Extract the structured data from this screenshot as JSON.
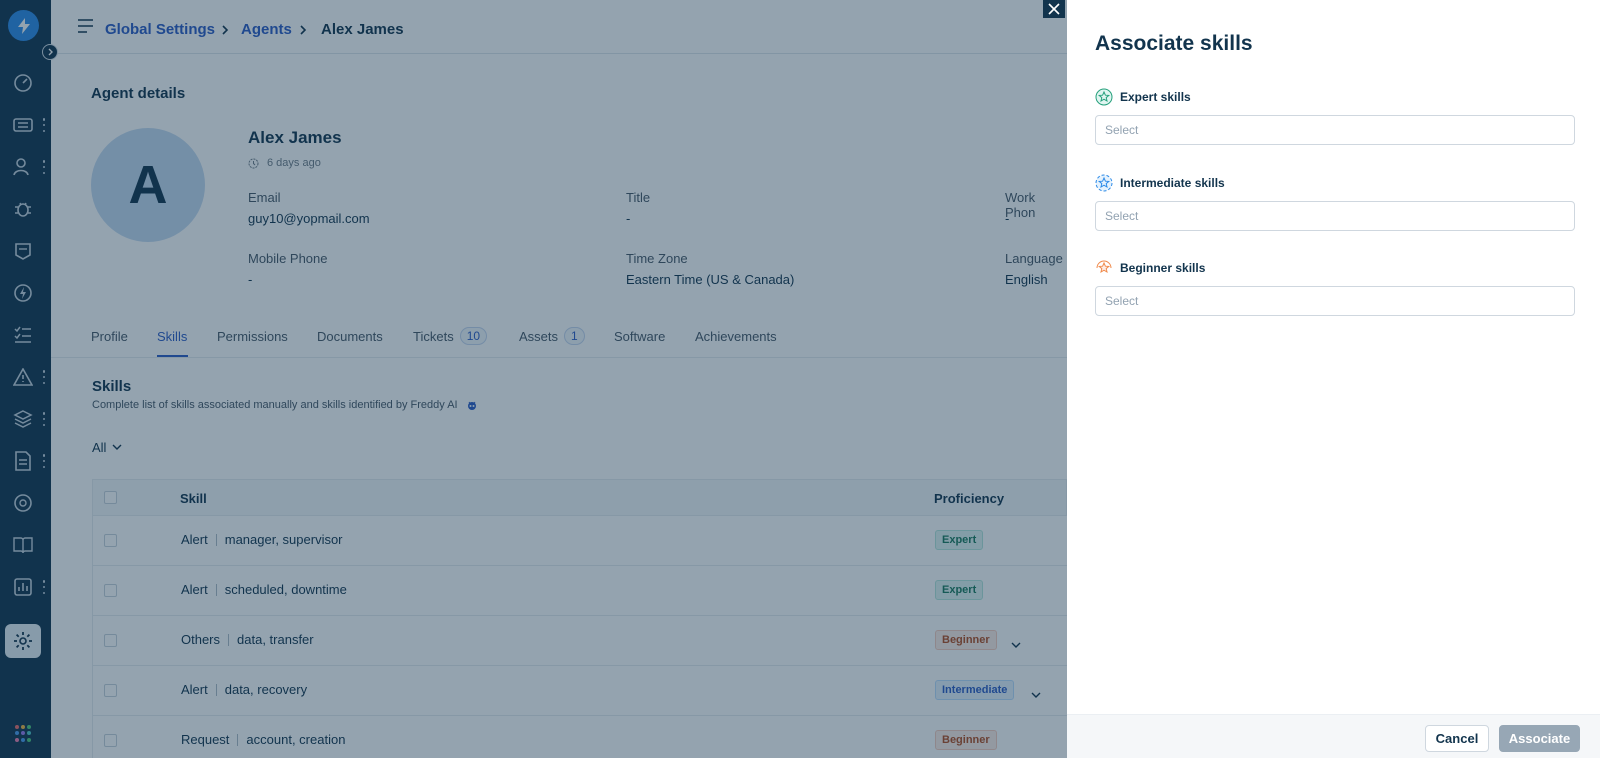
{
  "breadcrumb": {
    "root": "Global Settings",
    "section": "Agents",
    "current": "Alex James"
  },
  "agent": {
    "section_title": "Agent details",
    "avatar_letter": "A",
    "name": "Alex James",
    "last_seen": "6 days ago",
    "fields": {
      "email_label": "Email",
      "email_value": "guy10@yopmail.com",
      "title_label": "Title",
      "title_value": "-",
      "work_phone_label": "Work Phon",
      "work_phone_value": "-",
      "mobile_label": "Mobile Phone",
      "mobile_value": "-",
      "timezone_label": "Time Zone",
      "timezone_value": "Eastern Time (US & Canada)",
      "language_label": "Language",
      "language_value": "English"
    }
  },
  "tabs": [
    {
      "label": "Profile"
    },
    {
      "label": "Skills"
    },
    {
      "label": "Permissions"
    },
    {
      "label": "Documents"
    },
    {
      "label": "Tickets",
      "count": "10"
    },
    {
      "label": "Assets",
      "count": "1"
    },
    {
      "label": "Software"
    },
    {
      "label": "Achievements"
    }
  ],
  "skills": {
    "title": "Skills",
    "subtitle": "Complete list of skills associated manually and skills identified by Freddy AI",
    "filter": "All",
    "columns": {
      "skill": "Skill",
      "proficiency": "Proficiency"
    },
    "rows": [
      {
        "category": "Alert",
        "tags": "manager, supervisor",
        "level": "Expert"
      },
      {
        "category": "Alert",
        "tags": "scheduled, downtime",
        "level": "Expert"
      },
      {
        "category": "Others",
        "tags": "data, transfer",
        "level": "Beginner"
      },
      {
        "category": "Alert",
        "tags": "data, recovery",
        "level": "Intermediate"
      },
      {
        "category": "Request",
        "tags": "account, creation",
        "level": "Beginner"
      }
    ]
  },
  "panel": {
    "title": "Associate skills",
    "expert_label": "Expert skills",
    "expert_placeholder": "Select",
    "intermediate_label": "Intermediate skills",
    "intermediate_placeholder": "Select",
    "beginner_label": "Beginner skills",
    "beginner_placeholder": "Select",
    "cancel": "Cancel",
    "associate": "Associate"
  },
  "colors": {
    "rail": "#12344d",
    "link": "#2c5cc5",
    "overlay": "rgba(18,52,77,0.45)"
  }
}
